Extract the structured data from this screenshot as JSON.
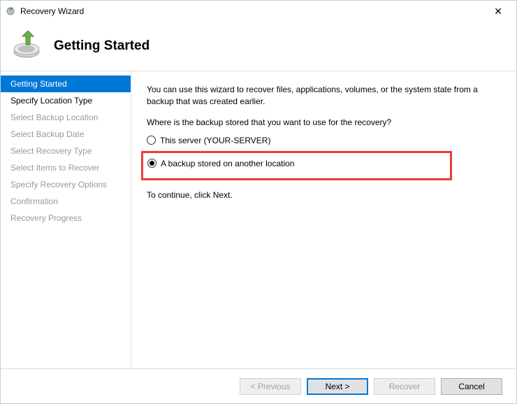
{
  "window": {
    "title": "Recovery Wizard",
    "close": "✕"
  },
  "header": {
    "title": "Getting Started"
  },
  "sidebar": {
    "items": [
      {
        "label": "Getting Started",
        "state": "active"
      },
      {
        "label": "Specify Location Type",
        "state": "enabled"
      },
      {
        "label": "Select Backup Location",
        "state": "disabled"
      },
      {
        "label": "Select Backup Date",
        "state": "disabled"
      },
      {
        "label": "Select Recovery Type",
        "state": "disabled"
      },
      {
        "label": "Select Items to Recover",
        "state": "disabled"
      },
      {
        "label": "Specify Recovery Options",
        "state": "disabled"
      },
      {
        "label": "Confirmation",
        "state": "disabled"
      },
      {
        "label": "Recovery Progress",
        "state": "disabled"
      }
    ]
  },
  "main": {
    "intro": "You can use this wizard to recover files, applications, volumes, or the system state from a backup that was created earlier.",
    "question": "Where is the backup stored that you want to use for the recovery?",
    "options": [
      {
        "label": "This server (YOUR-SERVER)",
        "selected": false,
        "highlighted": false
      },
      {
        "label": "A backup stored on another location",
        "selected": true,
        "highlighted": true
      }
    ],
    "continue_note": "To continue, click Next."
  },
  "footer": {
    "previous": "< Previous",
    "next": "Next >",
    "recover": "Recover",
    "cancel": "Cancel"
  }
}
